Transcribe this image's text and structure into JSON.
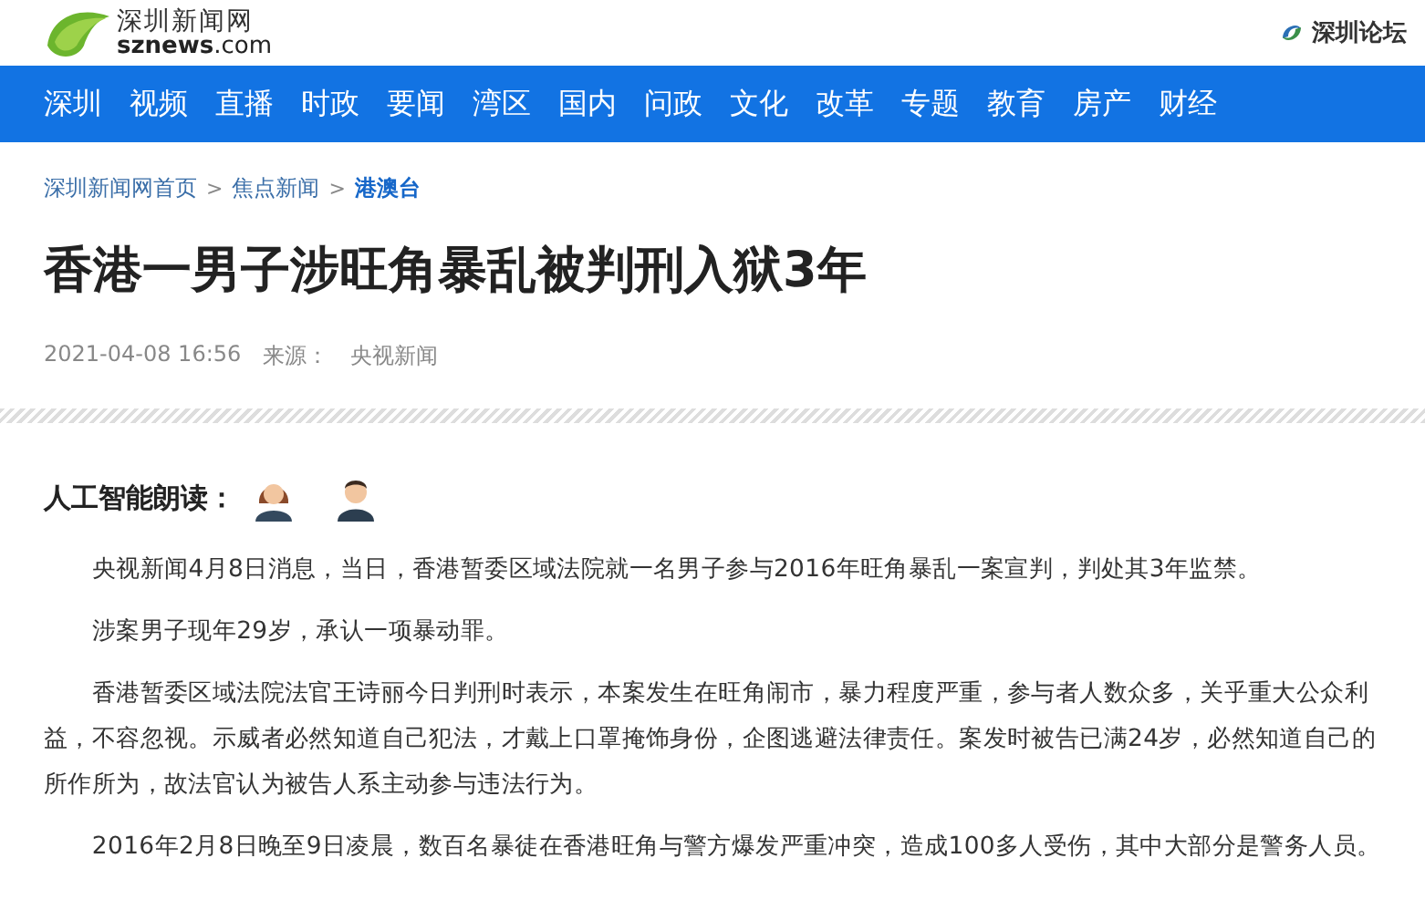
{
  "header": {
    "logo_cn": "深圳新闻网",
    "logo_domain_bold": "sznews",
    "logo_domain_rest": ".com",
    "forum_link": "深圳论坛"
  },
  "nav": {
    "items": [
      {
        "label": "深圳"
      },
      {
        "label": "视频"
      },
      {
        "label": "直播"
      },
      {
        "label": "时政"
      },
      {
        "label": "要闻"
      },
      {
        "label": "湾区"
      },
      {
        "label": "国内"
      },
      {
        "label": "问政"
      },
      {
        "label": "文化"
      },
      {
        "label": "改革"
      },
      {
        "label": "专题"
      },
      {
        "label": "教育"
      },
      {
        "label": "房产"
      },
      {
        "label": "财经"
      }
    ]
  },
  "breadcrumb": [
    {
      "label": "深圳新闻网首页",
      "current": false
    },
    {
      "label": "焦点新闻",
      "current": false
    },
    {
      "label": "港澳台",
      "current": true
    }
  ],
  "breadcrumb_separator": ">",
  "article": {
    "title": "香港一男子涉旺角暴乱被判刑入狱3年",
    "date": "2021-04-08 16:56",
    "source_label": "来源：",
    "source": "央视新闻",
    "ai_reading_label": "人工智能朗读：",
    "paragraphs": [
      "央视新闻4月8日消息，当日，香港暂委区域法院就一名男子参与2016年旺角暴乱一案宣判，判处其3年监禁。",
      "涉案男子现年29岁，承认一项暴动罪。",
      "香港暂委区域法院法官王诗丽今日判刑时表示，本案发生在旺角闹市，暴力程度严重，参与者人数众多，关乎重大公众利益，不容忽视。示威者必然知道自己犯法，才戴上口罩掩饰身份，企图逃避法律责任。案发时被告已满24岁，必然知道自己的所作所为，故法官认为被告人系主动参与违法行为。",
      "2016年2月8日晚至9日凌晨，数百名暴徒在香港旺角与警方爆发严重冲突，造成100多人受伤，其中大部分是警务人员。"
    ]
  }
}
